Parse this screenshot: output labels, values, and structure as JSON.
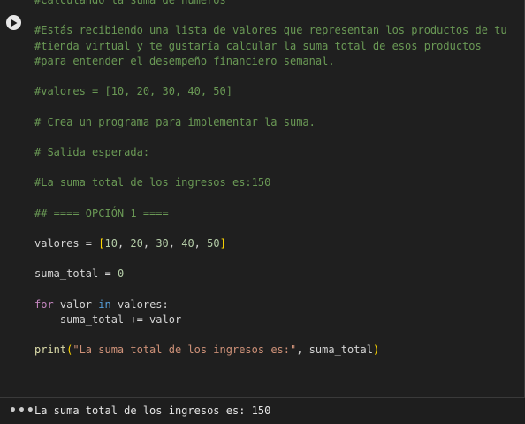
{
  "cell": {
    "run_button_icon": "play-icon",
    "code_lines": [
      {
        "tokens": [
          {
            "t": "#Calculando la suma de números",
            "k": "c"
          }
        ]
      },
      {
        "tokens": []
      },
      {
        "tokens": [
          {
            "t": "#Estás recibiendo una lista de valores que representan los productos de tu",
            "k": "c"
          }
        ]
      },
      {
        "tokens": [
          {
            "t": "#tienda virtual y te gustaría calcular la suma total de esos productos",
            "k": "c"
          }
        ]
      },
      {
        "tokens": [
          {
            "t": "#para entender el desempeño financiero semanal.",
            "k": "c"
          }
        ]
      },
      {
        "tokens": []
      },
      {
        "tokens": [
          {
            "t": "#valores = [10, 20, 30, 40, 50]",
            "k": "c"
          }
        ]
      },
      {
        "tokens": []
      },
      {
        "tokens": [
          {
            "t": "# Crea un programa para implementar la suma.",
            "k": "c"
          }
        ]
      },
      {
        "tokens": []
      },
      {
        "tokens": [
          {
            "t": "# Salida esperada:",
            "k": "c"
          }
        ]
      },
      {
        "tokens": []
      },
      {
        "tokens": [
          {
            "t": "#La suma total de los ingresos es:150",
            "k": "c"
          }
        ]
      },
      {
        "tokens": []
      },
      {
        "tokens": [
          {
            "t": "## ==== OPCIÓN 1 ====",
            "k": "c"
          }
        ]
      },
      {
        "tokens": []
      },
      {
        "tokens": [
          {
            "t": "valores",
            "k": "var"
          },
          {
            "t": " = ",
            "k": "var"
          },
          {
            "t": "[",
            "k": "br"
          },
          {
            "t": "10",
            "k": "num"
          },
          {
            "t": ", ",
            "k": "var"
          },
          {
            "t": "20",
            "k": "num"
          },
          {
            "t": ", ",
            "k": "var"
          },
          {
            "t": "30",
            "k": "num"
          },
          {
            "t": ", ",
            "k": "var"
          },
          {
            "t": "40",
            "k": "num"
          },
          {
            "t": ", ",
            "k": "var"
          },
          {
            "t": "50",
            "k": "num"
          },
          {
            "t": "]",
            "k": "br"
          }
        ]
      },
      {
        "tokens": []
      },
      {
        "tokens": [
          {
            "t": "suma_total",
            "k": "var"
          },
          {
            "t": " = ",
            "k": "var"
          },
          {
            "t": "0",
            "k": "num"
          }
        ]
      },
      {
        "tokens": []
      },
      {
        "tokens": [
          {
            "t": "for",
            "k": "kw2"
          },
          {
            "t": " valor ",
            "k": "var"
          },
          {
            "t": "in",
            "k": "kw"
          },
          {
            "t": " valores:",
            "k": "var"
          }
        ]
      },
      {
        "tokens": [
          {
            "t": "    suma_total += valor",
            "k": "var"
          }
        ]
      },
      {
        "tokens": []
      },
      {
        "tokens": [
          {
            "t": "print",
            "k": "fn"
          },
          {
            "t": "(",
            "k": "br"
          },
          {
            "t": "\"La suma total de los ingresos es:\"",
            "k": "str"
          },
          {
            "t": ", suma_total",
            "k": "var"
          },
          {
            "t": ")",
            "k": "br"
          }
        ]
      }
    ]
  },
  "output": {
    "menu_icon": "more-horizontal-icon",
    "menu_label": "•••",
    "text": "La suma total de los ingresos es: 150"
  },
  "colors": {
    "background": "#1f1f1f",
    "comment": "#6a9955",
    "keyword": "#569cd6",
    "control_keyword": "#c586c0",
    "function": "#dcdcaa",
    "string": "#ce9178",
    "number": "#b5cea8",
    "bracket": "#ffd700"
  }
}
